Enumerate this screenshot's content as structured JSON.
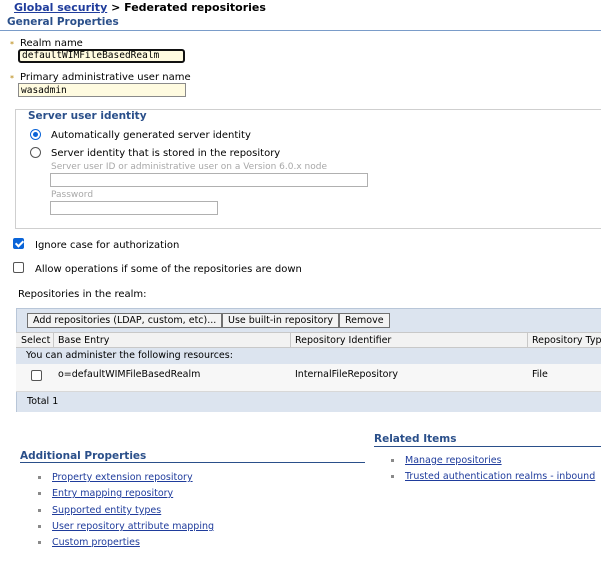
{
  "breadcrumb": {
    "parent": "Global security",
    "separator": " > ",
    "current": "Federated repositories"
  },
  "general_properties": {
    "title": "General Properties",
    "required_marker": "*",
    "realm_name": {
      "label": "Realm name",
      "value": "defaultWIMFileBasedRealm"
    },
    "primary_admin": {
      "label": "Primary administrative user name",
      "value": "wasadmin"
    }
  },
  "server_identity": {
    "legend": "Server user identity",
    "option_auto": "Automatically generated server identity",
    "option_repo": "Server identity that is stored in the repository",
    "selected": "auto",
    "user_id_label": "Server user ID or administrative user on a Version 6.0.x node",
    "password_label": "Password"
  },
  "options": {
    "ignore_case": {
      "label": "Ignore case for authorization",
      "checked": true
    },
    "allow_operations": {
      "label": "Allow operations if some of the repositories are down",
      "checked": false
    }
  },
  "repositories": {
    "caption": "Repositories in the realm:",
    "buttons": {
      "add": "Add repositories (LDAP, custom, etc)...",
      "builtin": "Use built-in repository",
      "remove": "Remove"
    },
    "columns": {
      "select": "Select",
      "base_entry": "Base Entry",
      "repo_id": "Repository Identifier",
      "repo_type": "Repository Type"
    },
    "resources_note": "You can administer the following resources:",
    "rows": [
      {
        "base_entry": "o=defaultWIMFileBasedRealm",
        "repo_id": "InternalFileRepository",
        "repo_type": "File"
      }
    ],
    "total": "Total 1"
  },
  "additional_properties": {
    "title": "Additional Properties",
    "links": [
      "Property extension repository",
      "Entry mapping repository",
      "Supported entity types",
      "User repository attribute mapping",
      "Custom properties"
    ]
  },
  "related_items": {
    "title": "Related Items",
    "links": [
      "Manage repositories",
      "Trusted authentication realms - inbound"
    ]
  }
}
